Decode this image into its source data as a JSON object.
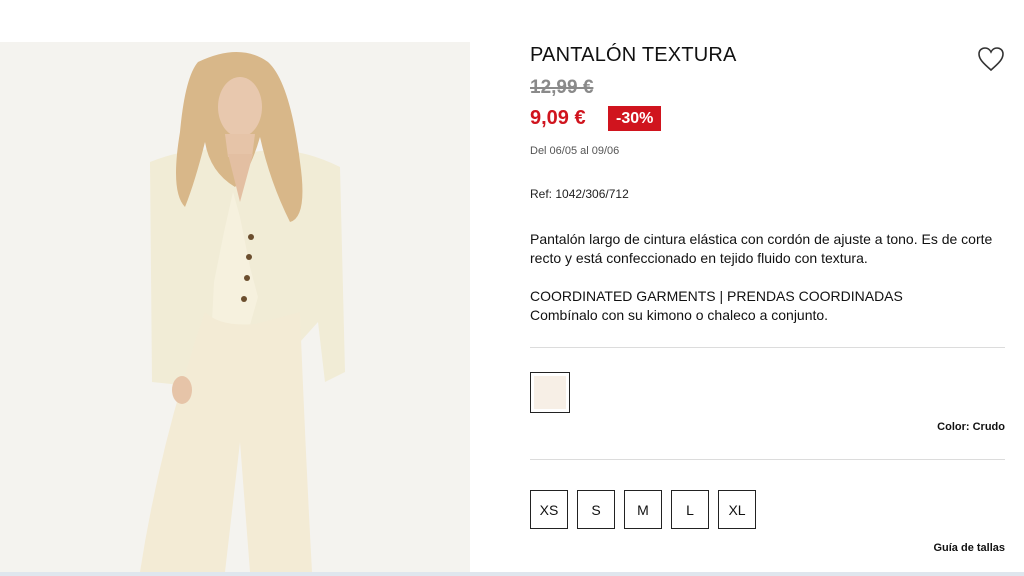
{
  "product": {
    "title": "PANTALÓN TEXTURA",
    "old_price": "12,99 €",
    "new_price": "9,09 €",
    "discount": "-30%",
    "dates": "Del 06/05 al 09/06",
    "ref": "Ref: 1042/306/712",
    "description": "Pantalón largo de cintura elástica con cordón de ajuste a tono. Es de corte recto y está confeccionado en tejido fluido con textura.",
    "coordinated_title": "COORDINATED GARMENTS | PRENDAS COORDINADAS",
    "coordinated_text": "Combínalo con su kimono o chaleco a conjunto.",
    "color_label": "Color: Crudo",
    "size_guide": "Guía de tallas"
  },
  "sizes": [
    "XS",
    "S",
    "M",
    "L",
    "XL"
  ],
  "colors": {
    "price_red": "#d0141e",
    "swatch_crudo": "#f7efe6"
  },
  "icons": {
    "wishlist": "heart-icon"
  }
}
